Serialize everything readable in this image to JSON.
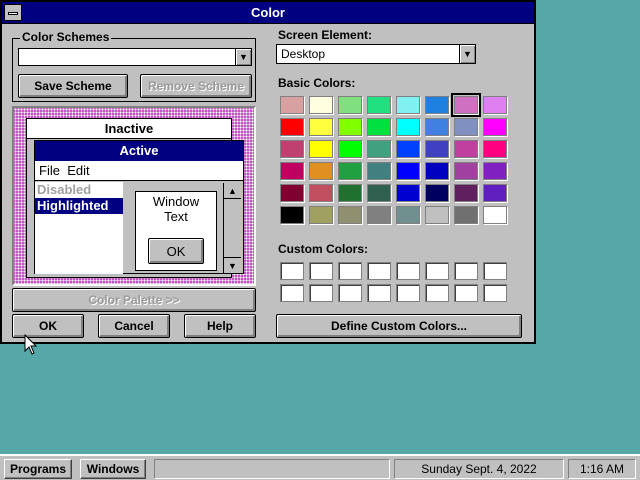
{
  "window": {
    "title": "Color"
  },
  "schemes": {
    "label": "Color Schemes",
    "value": "",
    "save_label": "Save Scheme",
    "remove_label": "Remove Scheme"
  },
  "preview": {
    "inactive_title": "Inactive",
    "active_title": "Active",
    "menu": [
      "File",
      "Edit"
    ],
    "disabled_label": "Disabled",
    "highlighted_label": "Highlighted",
    "window_text_line1": "Window",
    "window_text_line2": "Text",
    "ok_label": "OK"
  },
  "palette_button": "Color Palette >>",
  "buttons": {
    "ok": "OK",
    "cancel": "Cancel",
    "help": "Help"
  },
  "screen_element": {
    "label": "Screen Element:",
    "value": "Desktop"
  },
  "basic_colors": {
    "label": "Basic Colors:",
    "selected_index": 6,
    "colors": [
      "#d8a0a0",
      "#ffffe0",
      "#80e080",
      "#20e080",
      "#80f0f0",
      "#2080e0",
      "#d070c0",
      "#e080f0",
      "#ff0000",
      "#ffff40",
      "#80ff00",
      "#00e040",
      "#00ffff",
      "#4080e0",
      "#8090c0",
      "#ff00ff",
      "#c04070",
      "#ffff00",
      "#00ff00",
      "#40a080",
      "#0040ff",
      "#4040c0",
      "#c040a0",
      "#ff0080",
      "#c00060",
      "#e09020",
      "#20a040",
      "#408080",
      "#0000ff",
      "#0000c0",
      "#a040a0",
      "#8020c0",
      "#800030",
      "#c05060",
      "#207030",
      "#306050",
      "#0000d0",
      "#000060",
      "#602060",
      "#6020c0",
      "#000000",
      "#a0a060",
      "#909070",
      "#808080",
      "#709090",
      "#c0c0c0",
      "#707070",
      "#ffffff"
    ]
  },
  "custom_colors": {
    "label": "Custom Colors:",
    "count": 16
  },
  "define_button": "Define Custom Colors...",
  "taskbar": {
    "programs": "Programs",
    "windows": "Windows",
    "date": "Sunday Sept. 4, 2022",
    "time": "1:16 AM"
  }
}
